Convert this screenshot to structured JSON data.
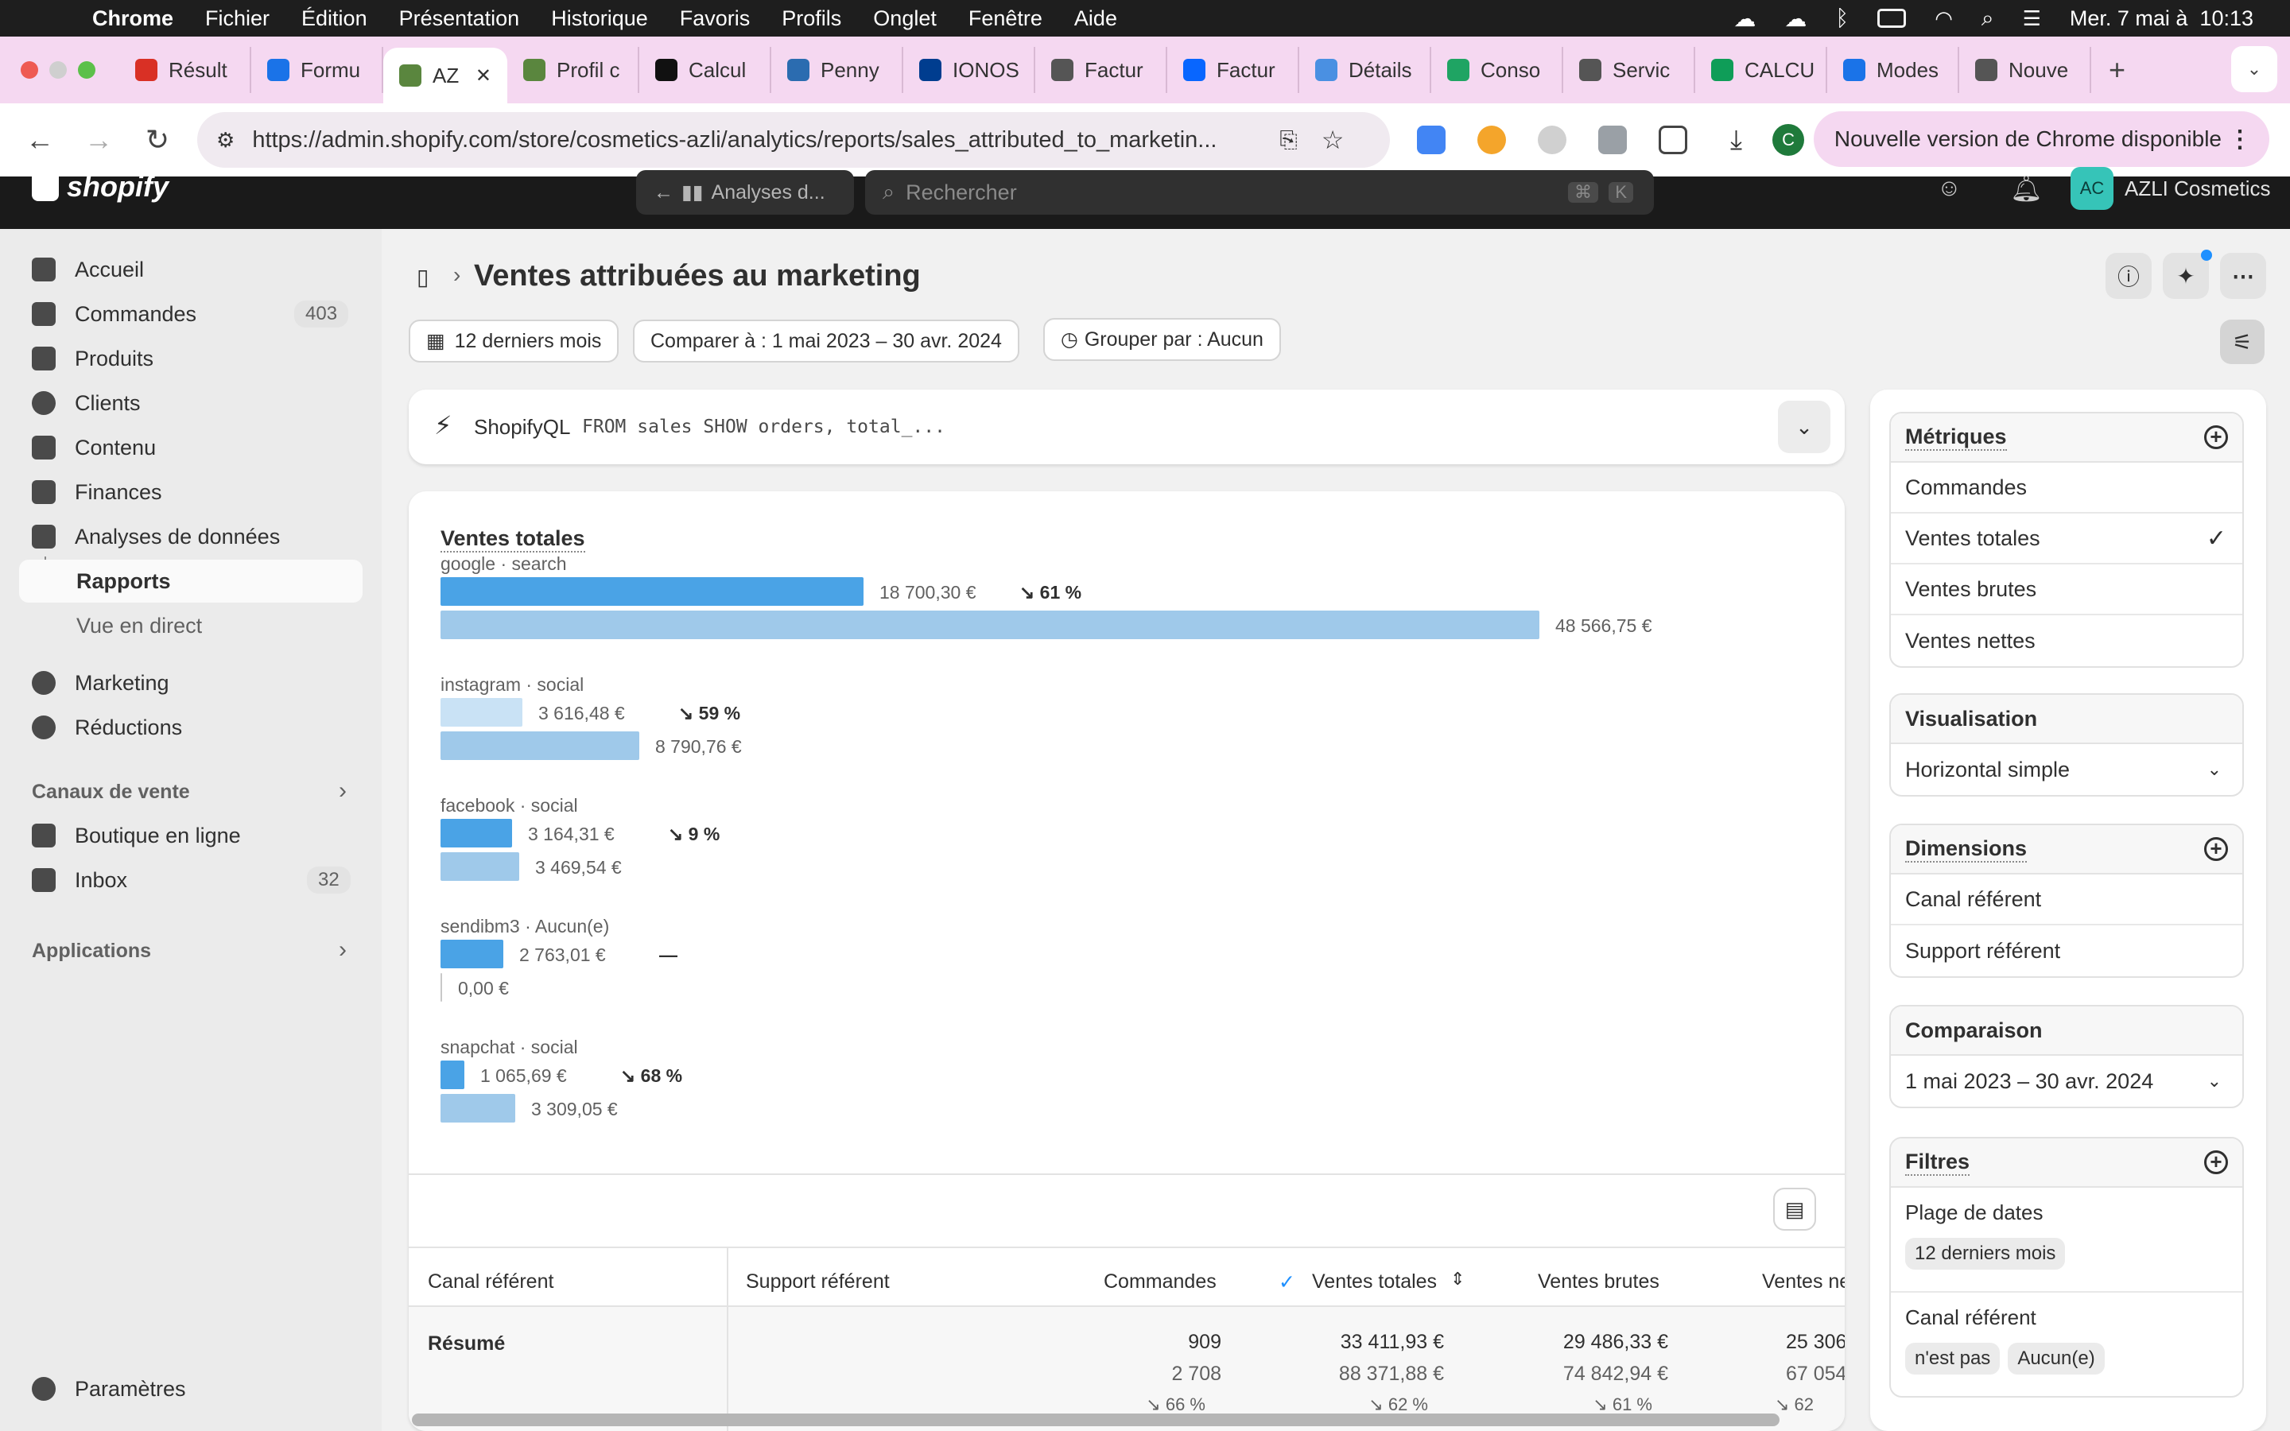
{
  "menubar": {
    "app": "Chrome",
    "items": [
      "Fichier",
      "Édition",
      "Présentation",
      "Historique",
      "Favoris",
      "Profils",
      "Onglet",
      "Fenêtre",
      "Aide"
    ],
    "clock": "Mer. 7 mai à  10:13"
  },
  "tabs": [
    {
      "label": "Résult",
      "color": "#d93025"
    },
    {
      "label": "Formu",
      "color": "#1a73e8"
    },
    {
      "label": "AZ",
      "color": "#5a863e",
      "active": true
    },
    {
      "label": "Profil c",
      "color": "#5a863e"
    },
    {
      "label": "Calcul",
      "color": "#111111"
    },
    {
      "label": "Penny",
      "color": "#2b6cb0"
    },
    {
      "label": "IONOS",
      "color": "#003d8f"
    },
    {
      "label": "Factur",
      "color": "#555555"
    },
    {
      "label": "Factur",
      "color": "#0866ff"
    },
    {
      "label": "Détails",
      "color": "#4a90e2"
    },
    {
      "label": "Conso",
      "color": "#1fa463"
    },
    {
      "label": "Servic",
      "color": "#555555"
    },
    {
      "label": "CALCU",
      "color": "#0f9d58"
    },
    {
      "label": "Modes",
      "color": "#1a73e8"
    },
    {
      "label": "Nouve",
      "color": "#555555"
    }
  ],
  "address": {
    "url": "https://admin.shopify.com/store/cosmetics-azli/analytics/reports/sales_attributed_to_marketin...",
    "update": "Nouvelle version de Chrome disponible",
    "profile_initial": "C"
  },
  "shopify": {
    "logo": "shopify",
    "back_label": "Analyses d...",
    "search_placeholder": "Rechercher",
    "kbd1": "⌘",
    "kbd2": "K",
    "avatar": "AC",
    "store": "AZLI Cosmetics"
  },
  "sidebar": {
    "items": [
      {
        "label": "Accueil"
      },
      {
        "label": "Commandes",
        "badge": "403"
      },
      {
        "label": "Produits"
      },
      {
        "label": "Clients"
      },
      {
        "label": "Contenu"
      },
      {
        "label": "Finances"
      },
      {
        "label": "Analyses de données"
      },
      {
        "label": "Rapports"
      },
      {
        "label": "Vue en direct"
      },
      {
        "label": "Marketing"
      },
      {
        "label": "Réductions"
      }
    ],
    "sales_channels": "Canaux de vente",
    "channels": [
      {
        "label": "Boutique en ligne"
      },
      {
        "label": "Inbox",
        "badge": "32"
      }
    ],
    "applications": "Applications",
    "settings": "Paramètres"
  },
  "page": {
    "title": "Ventes attribuées au marketing",
    "period": "12 derniers mois",
    "compare": "Comparer à : 1 mai 2023 – 30 avr. 2024",
    "group": "Grouper par : Aucun",
    "ql_label": "ShopifyQL",
    "ql_query": "FROM sales SHOW orders, total_..."
  },
  "chart_data": {
    "type": "bar",
    "orientation": "horizontal",
    "title": "Ventes totales",
    "categories": [
      "google · search",
      "instagram · social",
      "facebook · social",
      "sendibm3 · Aucun(e)",
      "snapchat · social"
    ],
    "series": [
      {
        "values": [
          18700.3,
          3616.48,
          3164.31,
          2763.01,
          1065.69
        ],
        "labels": [
          "18 700,30 €",
          "3 616,48 €",
          "3 164,31 €",
          "2 763,01 €",
          "1 065,69 €"
        ],
        "color": "#4aa3e6"
      },
      {
        "values": [
          48566.75,
          8790.76,
          3469.54,
          0.0,
          3309.05
        ],
        "labels": [
          "48 566,75 €",
          "8 790,76 €",
          "3 469,54 €",
          "0,00 €",
          "3 309,05 €"
        ],
        "color": "#9fc9ea"
      }
    ],
    "changes": [
      "↘ 61 %",
      "↘ 59 %",
      "↘ 9 %",
      "—",
      "↘ 68 %"
    ],
    "change_types": [
      "down",
      "down",
      "down",
      "flat",
      "down"
    ]
  },
  "table": {
    "headers": [
      "Canal référent",
      "Support référent",
      "Commandes",
      "Ventes totales",
      "Ventes brutes",
      "Ventes ne"
    ],
    "summary_label": "Résumé",
    "summary": {
      "orders": [
        "909",
        "2 708",
        "↘ 66 %"
      ],
      "total": [
        "33 411,93 €",
        "88 371,88 €",
        "↘ 62 %"
      ],
      "gross": [
        "29 486,33 €",
        "74 842,94 €",
        "↘ 61 %"
      ],
      "net": [
        "25 306,",
        "67 054,",
        "↘ 62"
      ]
    }
  },
  "panel": {
    "metrics": {
      "title": "Métriques",
      "items": [
        "Commandes",
        "Ventes totales",
        "Ventes brutes",
        "Ventes nettes"
      ],
      "checked": 1
    },
    "visualization": {
      "title": "Visualisation",
      "value": "Horizontal simple"
    },
    "dimensions": {
      "title": "Dimensions",
      "items": [
        "Canal référent",
        "Support référent"
      ]
    },
    "comparison": {
      "title": "Comparaison",
      "value": "1 mai 2023 – 30 avr. 2024"
    },
    "filters": {
      "title": "Filtres",
      "date_label": "Plage de dates",
      "date_chip": "12 derniers mois",
      "channel_label": "Canal référent",
      "chip1": "n'est pas",
      "chip2": "Aucun(e)"
    }
  }
}
